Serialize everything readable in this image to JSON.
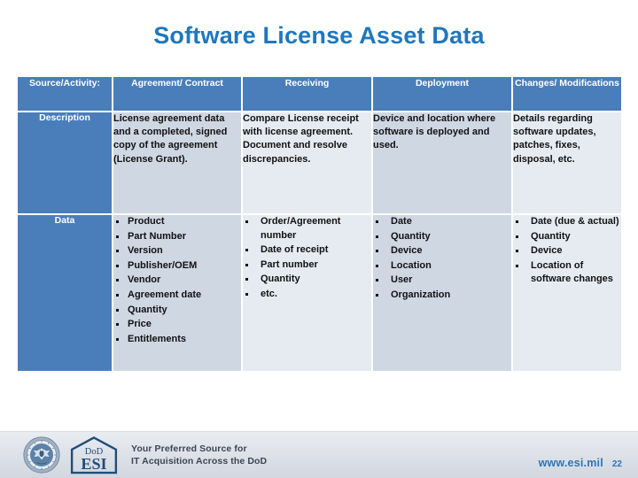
{
  "slide": {
    "title": "Software License Asset Data"
  },
  "table": {
    "headers": [
      {
        "label": "Source/Activity:"
      },
      {
        "label": "Agreement/ Contract"
      },
      {
        "label": "Receiving"
      },
      {
        "label": "Deployment"
      },
      {
        "label": "Changes/ Modifications"
      }
    ],
    "rows": [
      {
        "label": "Description",
        "cells": [
          {
            "text": "License agreement data and a completed, signed copy of the agreement (License Grant)."
          },
          {
            "text": "Compare License receipt with license agreement. Document and resolve discrepancies."
          },
          {
            "text": "Device and location where software is deployed and used."
          },
          {
            "text": "Details regarding software updates, patches, fixes, disposal, etc."
          }
        ]
      },
      {
        "label": "Data",
        "cells": [
          {
            "bullets": [
              "Product",
              "Part Number",
              "Version",
              "Publisher/OEM",
              "Vendor",
              "Agreement date",
              "Quantity",
              "Price",
              "Entitlements"
            ]
          },
          {
            "bullets": [
              "Order/Agreement number",
              "Date of receipt",
              "Part number",
              "Quantity",
              "etc."
            ]
          },
          {
            "bullets": [
              "Date",
              "Quantity",
              "Device",
              "Location",
              "User",
              "Organization"
            ]
          },
          {
            "bullets": [
              "Date (due & actual)",
              "Quantity",
              "Device",
              "Location of software changes"
            ]
          }
        ]
      }
    ]
  },
  "footer": {
    "logo_line1": "DoD",
    "logo_line2": "ESI",
    "tagline_line1": "Your Preferred Source for",
    "tagline_line2": "IT Acquisition Across the DoD",
    "site_url": "www.esi.mil",
    "page_number": "22"
  },
  "colors": {
    "title_blue": "#1F77BE",
    "header_blue": "#4A7EBB",
    "cell_bg": "#CFD7E3",
    "cell_bg_alt": "#E6EBF2",
    "link_blue": "#2E75B6"
  }
}
